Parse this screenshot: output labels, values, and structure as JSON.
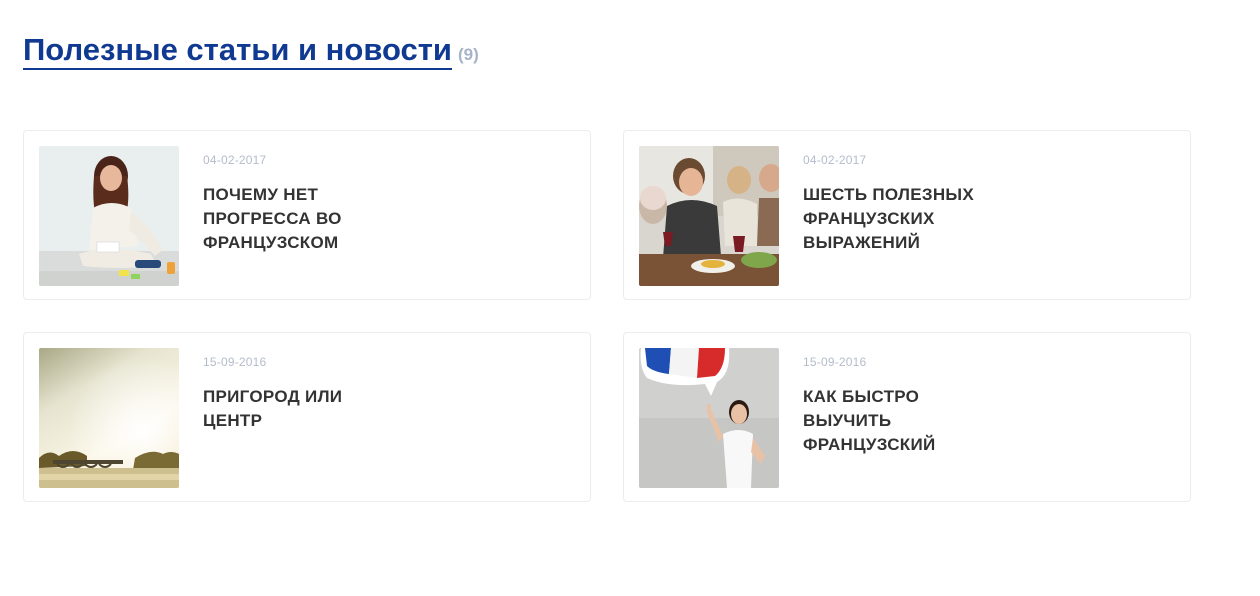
{
  "section": {
    "title": "Полезные статьи и новости",
    "count": "(9)"
  },
  "articles": [
    {
      "date": "04-02-2017",
      "title": "ПОЧЕМУ НЕТ ПРОГРЕССА ВО ФРАНЦУЗСКОМ",
      "image": "woman-writing-photo"
    },
    {
      "date": "04-02-2017",
      "title": "ШЕСТЬ ПОЛЕЗНЫХ ФРАНЦУЗСКИХ ВЫРАЖЕНИЙ",
      "image": "family-dinner-photo"
    },
    {
      "date": "15-09-2016",
      "title": "ПРИГОРОД ИЛИ ЦЕНТР",
      "image": "river-bridge-photo"
    },
    {
      "date": "15-09-2016",
      "title": "КАК БЫСТРО ВЫУЧИТЬ ФРАНЦУЗСКИЙ",
      "image": "woman-french-flag-photo"
    }
  ]
}
